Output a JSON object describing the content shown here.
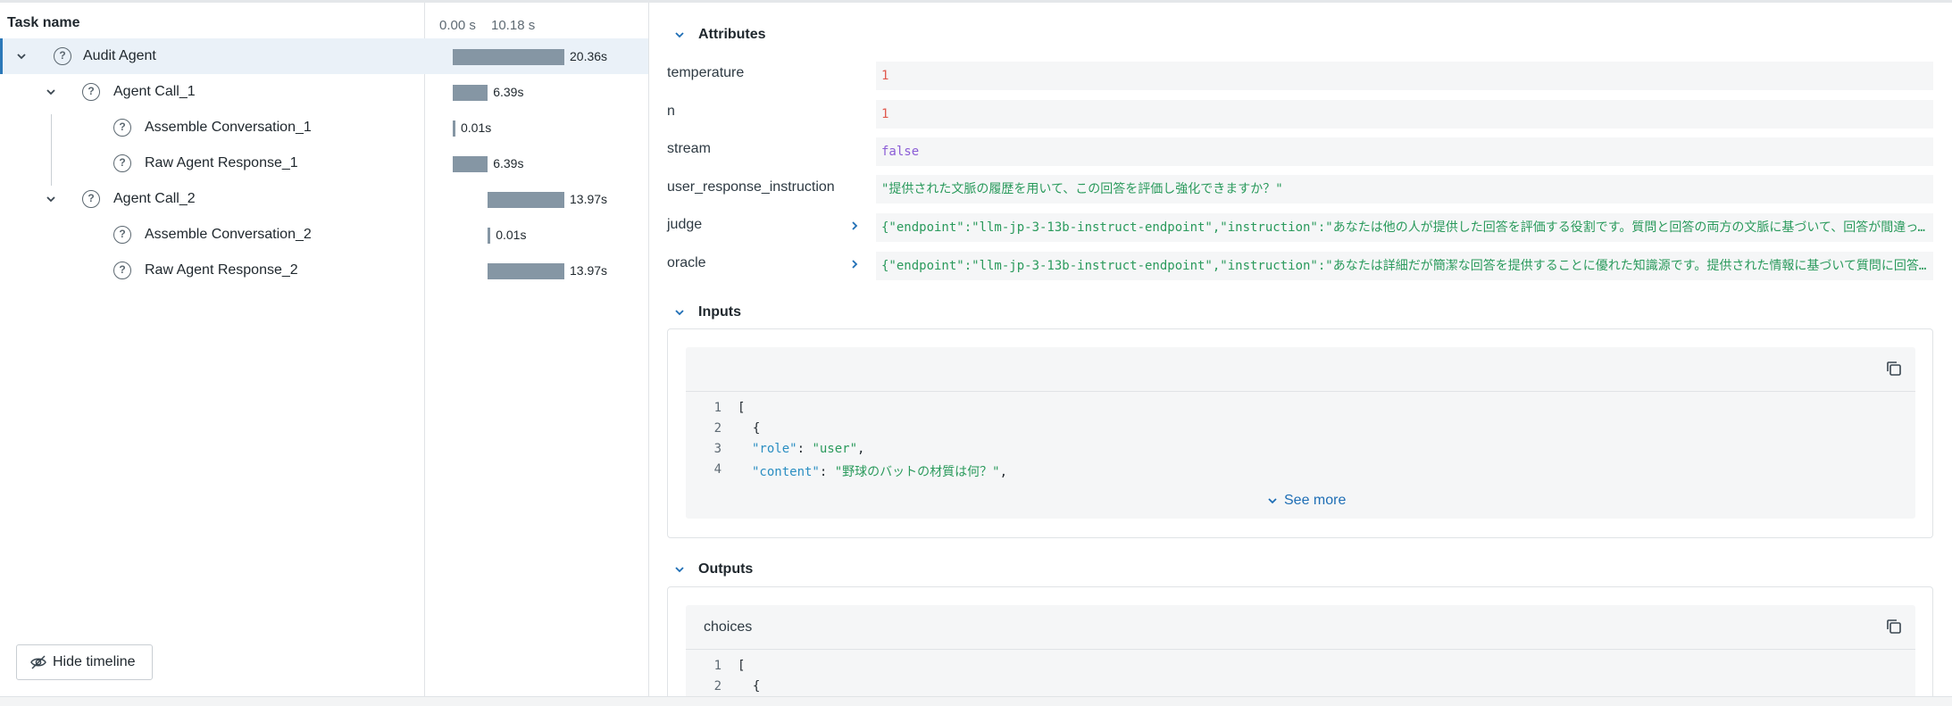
{
  "tree": {
    "header": "Task name",
    "rows": [
      {
        "label": "Audit Agent"
      },
      {
        "label": "Agent Call_1"
      },
      {
        "label": "Assemble Conversation_1"
      },
      {
        "label": "Raw Agent Response_1"
      },
      {
        "label": "Agent Call_2"
      },
      {
        "label": "Assemble Conversation_2"
      },
      {
        "label": "Raw Agent Response_2"
      }
    ],
    "hide_timeline_label": "Hide timeline"
  },
  "timeline": {
    "tick_start": "0.00 s",
    "tick_mid": "10.18 s",
    "rows": [
      {
        "start_s": 0.0,
        "duration_s": 20.36,
        "label": "20.36s"
      },
      {
        "start_s": 0.0,
        "duration_s": 6.39,
        "label": "6.39s"
      },
      {
        "start_s": 0.0,
        "duration_s": 0.01,
        "label": "0.01s"
      },
      {
        "start_s": 0.0,
        "duration_s": 6.39,
        "label": "6.39s"
      },
      {
        "start_s": 6.39,
        "duration_s": 13.97,
        "label": "13.97s"
      },
      {
        "start_s": 6.39,
        "duration_s": 0.01,
        "label": "0.01s"
      },
      {
        "start_s": 6.39,
        "duration_s": 13.97,
        "label": "13.97s"
      }
    ]
  },
  "details": {
    "attributes_title": "Attributes",
    "attributes": [
      {
        "key": "temperature",
        "value": "1"
      },
      {
        "key": "n",
        "value": "1"
      },
      {
        "key": "stream",
        "value": "false"
      },
      {
        "key": "user_response_instruction",
        "value": "\"提供された文脈の履歴を用いて、この回答を評価し強化できますか？\""
      },
      {
        "key": "judge",
        "value": "{\"endpoint\":\"llm-jp-3-13b-instruct-endpoint\",\"instruction\":\"あなたは他の人が提供した回答を評価する役割です。質問と回答の両方の文脈に基づいて、回答が間違って…"
      },
      {
        "key": "oracle",
        "value": "{\"endpoint\":\"llm-jp-3-13b-instruct-endpoint\",\"instruction\":\"あなたは詳細だが簡潔な回答を提供することに優れた知識源です。提供された情報に基づいて質問に回答し…"
      }
    ],
    "inputs_title": "Inputs",
    "inputs_code": [
      {
        "n": "1",
        "text": "["
      },
      {
        "n": "2",
        "text": "  {"
      },
      {
        "n": "3",
        "key": "\"role\"",
        "sep": ": ",
        "val": "\"user\"",
        "tail": ","
      },
      {
        "n": "4",
        "key": "\"content\"",
        "sep": ": ",
        "val": "\"野球のバットの材質は何？\"",
        "tail": ","
      }
    ],
    "see_more_label": "See more",
    "outputs_title": "Outputs",
    "outputs_box_title": "choices",
    "outputs_code": [
      {
        "n": "1",
        "text": "["
      },
      {
        "n": "2",
        "text": "  {"
      }
    ]
  },
  "colors": {
    "accent": "#2b78b8",
    "bar": "#8596a4",
    "number": "#e05a4f",
    "boolean": "#8b5dd6",
    "string": "#2a9a5c",
    "json_key": "#2a8ec2"
  }
}
